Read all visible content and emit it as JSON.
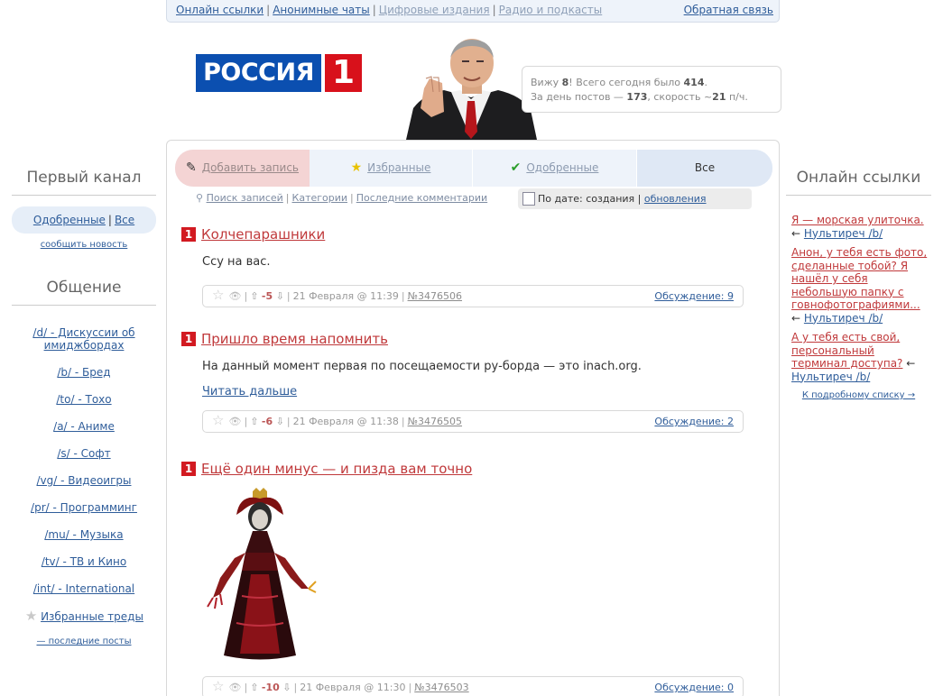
{
  "topbar": {
    "links": [
      "Онлайн ссылки",
      "Анонимные чаты",
      "Цифровые издания",
      "Радио и подкасты"
    ],
    "feedback": "Обратная связь"
  },
  "logo": {
    "word": "РОССИЯ",
    "number": "1"
  },
  "stats": {
    "line1_prefix": "Вижу ",
    "viewing": "8",
    "line1_mid": "! Всего сегодня было ",
    "today_total": "414",
    "line1_end": ".",
    "line2_prefix": "За день постов — ",
    "posts_today": "173",
    "line2_mid": ", скорость ~",
    "speed": "21",
    "line2_end": " п/ч."
  },
  "left": {
    "channel_title": "Первый канал",
    "approved": "Одобренные",
    "all": "Все",
    "report": "сообщить новость",
    "chat_title": "Общение",
    "boards": [
      "/d/ - Дискуссии об имиджбордах",
      "/b/ - Бред",
      "/to/ - Тохо",
      "/a/ - Аниме",
      "/s/ - Софт",
      "/vg/ - Видеоигры",
      "/pr/ - Программинг",
      "/mu/ - Музыка",
      "/tv/ - ТВ и Кино",
      "/int/ - International"
    ],
    "favorites": "Избранные треды",
    "last_posts": "— последние посты"
  },
  "right": {
    "title": "Онлайн ссылки",
    "links": [
      {
        "text": "Я — морская улиточка.",
        "board": "Нультиреч /b/"
      },
      {
        "text": "Анон, у тебя есть фото, сделанные тобой? Я нашёл у себя небольшую папку с говнофотографиями...",
        "board": "Нультиреч /b/"
      },
      {
        "text": "А у тебя есть свой, персональный терминал доступа?",
        "board": "Нультиреч /b/"
      }
    ],
    "arrow": "←",
    "more": "К подробному списку →"
  },
  "tabs": {
    "add": "Добавить запись",
    "favorites": "Избранные",
    "approved": "Одобренные",
    "all": "Все"
  },
  "subnav": {
    "search": "Поиск записей",
    "categories": "Категории",
    "last_comments": "Последние комментарии"
  },
  "sort": {
    "label": "По дате: создания",
    "updates": "обновления"
  },
  "posts": [
    {
      "title": "Колчепарашники",
      "body": "Ссу на вас.",
      "rating": "-5",
      "date": "21 Февраля @ 11:39",
      "id": "№3476506",
      "discussion": "Обсуждение: 9"
    },
    {
      "title": "Пришло время напомнить",
      "body": "На данный момент первая по посещаемости ру-борда — это inach.org.",
      "readmore": "Читать дальше",
      "rating": "-6",
      "date": "21 Февраля @ 11:38",
      "id": "№3476505",
      "discussion": "Обсуждение: 2"
    },
    {
      "title": "Ещё один минус — и пизда вам точно",
      "rating": "-10",
      "date": "21 Февраля @ 11:30",
      "id": "№3476503",
      "discussion": "Обсуждение: 0"
    }
  ],
  "badge": "1"
}
